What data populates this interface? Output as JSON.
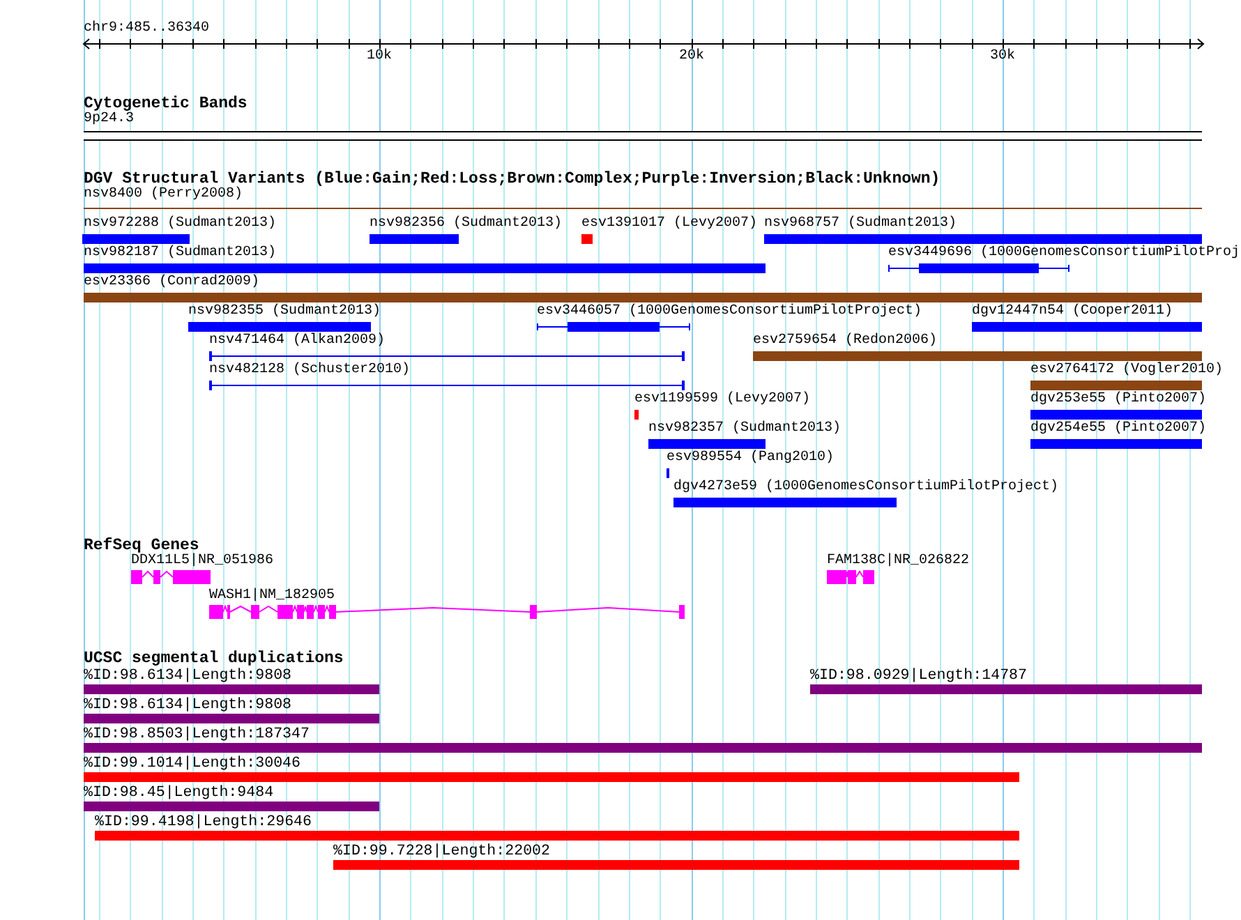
{
  "ruler": {
    "title": "chr9:485..36340",
    "ticks": [
      "10k",
      "20k",
      "30k"
    ]
  },
  "cytogenetic_bands": {
    "title": "Cytogenetic Bands",
    "band": "9p24.3"
  },
  "dgv": {
    "title": "DGV Structural Variants (Blue:Gain;Red:Loss;Brown:Complex;Purple:Inversion;Black:Unknown)",
    "features": [
      {
        "label": "nsv8400 (Perry2008)",
        "kind": "complex"
      },
      {
        "label": "nsv972288 (Sudmant2013)",
        "kind": "gain"
      },
      {
        "label": "nsv982356 (Sudmant2013)",
        "kind": "gain"
      },
      {
        "label": "esv1391017 (Levy2007)",
        "kind": "loss"
      },
      {
        "label": "nsv968757 (Sudmant2013)",
        "kind": "gain"
      },
      {
        "label": "nsv982187 (Sudmant2013)",
        "kind": "gain"
      },
      {
        "label": "esv3449696 (1000GenomesConsortiumPilotProj",
        "kind": "gain"
      },
      {
        "label": "esv23366 (Conrad2009)",
        "kind": "complex"
      },
      {
        "label": "nsv982355 (Sudmant2013)",
        "kind": "gain"
      },
      {
        "label": "esv3446057 (1000GenomesConsortiumPilotProject)",
        "kind": "gain"
      },
      {
        "label": "dgv12447n54 (Cooper2011)",
        "kind": "gain"
      },
      {
        "label": "nsv471464 (Alkan2009)",
        "kind": "gain"
      },
      {
        "label": "esv2759654 (Redon2006)",
        "kind": "complex"
      },
      {
        "label": "nsv482128 (Schuster2010)",
        "kind": "gain"
      },
      {
        "label": "esv2764172 (Vogler2010)",
        "kind": "complex"
      },
      {
        "label": "esv1199599 (Levy2007)",
        "kind": "loss"
      },
      {
        "label": "dgv253e55 (Pinto2007)",
        "kind": "gain"
      },
      {
        "label": "nsv982357 (Sudmant2013)",
        "kind": "gain"
      },
      {
        "label": "dgv254e55 (Pinto2007)",
        "kind": "gain"
      },
      {
        "label": "esv989554 (Pang2010)",
        "kind": "gain"
      },
      {
        "label": "dgv4273e59 (1000GenomesConsortiumPilotProject)",
        "kind": "gain"
      }
    ]
  },
  "refseq_genes": {
    "title": "RefSeq Genes",
    "genes": [
      {
        "label": "DDX11L5|NR_051986"
      },
      {
        "label": "FAM138C|NR_026822"
      },
      {
        "label": "WASH1|NM_182905"
      }
    ]
  },
  "segmental_duplications": {
    "title": "UCSC segmental duplications",
    "features": [
      {
        "label": "%ID:98.6134|Length:9808",
        "color": "#800080"
      },
      {
        "label": "%ID:98.0929|Length:14787",
        "color": "#800080"
      },
      {
        "label": "%ID:98.6134|Length:9808",
        "color": "#800080"
      },
      {
        "label": "%ID:98.8503|Length:187347",
        "color": "#800080"
      },
      {
        "label": "%ID:99.1014|Length:30046",
        "color": "#ff0000"
      },
      {
        "label": "%ID:98.45|Length:9484",
        "color": "#800080"
      },
      {
        "label": "%ID:99.4198|Length:29646",
        "color": "#ff0000"
      },
      {
        "label": "%ID:99.7228|Length:22002",
        "color": "#ff0000"
      }
    ]
  }
}
